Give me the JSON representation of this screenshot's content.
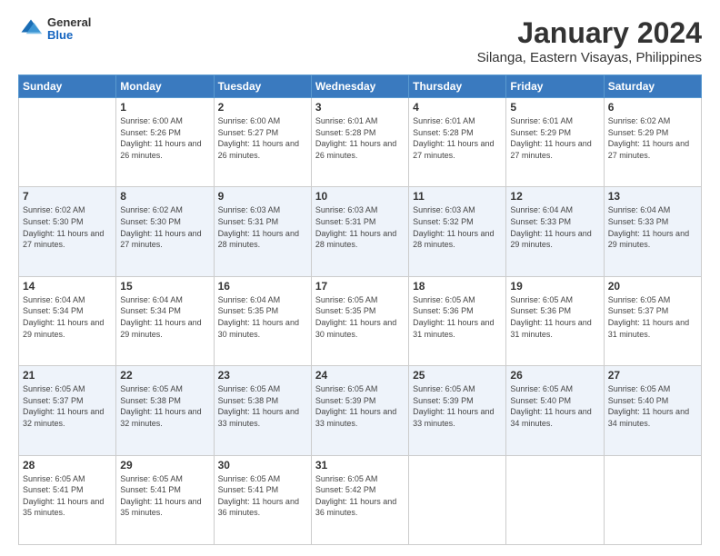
{
  "logo": {
    "general": "General",
    "blue": "Blue"
  },
  "header": {
    "title": "January 2024",
    "subtitle": "Silanga, Eastern Visayas, Philippines"
  },
  "days_of_week": [
    "Sunday",
    "Monday",
    "Tuesday",
    "Wednesday",
    "Thursday",
    "Friday",
    "Saturday"
  ],
  "weeks": [
    [
      {
        "day": "",
        "content": ""
      },
      {
        "day": "1",
        "sunrise": "Sunrise: 6:00 AM",
        "sunset": "Sunset: 5:26 PM",
        "daylight": "Daylight: 11 hours and 26 minutes."
      },
      {
        "day": "2",
        "sunrise": "Sunrise: 6:00 AM",
        "sunset": "Sunset: 5:27 PM",
        "daylight": "Daylight: 11 hours and 26 minutes."
      },
      {
        "day": "3",
        "sunrise": "Sunrise: 6:01 AM",
        "sunset": "Sunset: 5:28 PM",
        "daylight": "Daylight: 11 hours and 26 minutes."
      },
      {
        "day": "4",
        "sunrise": "Sunrise: 6:01 AM",
        "sunset": "Sunset: 5:28 PM",
        "daylight": "Daylight: 11 hours and 27 minutes."
      },
      {
        "day": "5",
        "sunrise": "Sunrise: 6:01 AM",
        "sunset": "Sunset: 5:29 PM",
        "daylight": "Daylight: 11 hours and 27 minutes."
      },
      {
        "day": "6",
        "sunrise": "Sunrise: 6:02 AM",
        "sunset": "Sunset: 5:29 PM",
        "daylight": "Daylight: 11 hours and 27 minutes."
      }
    ],
    [
      {
        "day": "7",
        "sunrise": "Sunrise: 6:02 AM",
        "sunset": "Sunset: 5:30 PM",
        "daylight": "Daylight: 11 hours and 27 minutes."
      },
      {
        "day": "8",
        "sunrise": "Sunrise: 6:02 AM",
        "sunset": "Sunset: 5:30 PM",
        "daylight": "Daylight: 11 hours and 27 minutes."
      },
      {
        "day": "9",
        "sunrise": "Sunrise: 6:03 AM",
        "sunset": "Sunset: 5:31 PM",
        "daylight": "Daylight: 11 hours and 28 minutes."
      },
      {
        "day": "10",
        "sunrise": "Sunrise: 6:03 AM",
        "sunset": "Sunset: 5:31 PM",
        "daylight": "Daylight: 11 hours and 28 minutes."
      },
      {
        "day": "11",
        "sunrise": "Sunrise: 6:03 AM",
        "sunset": "Sunset: 5:32 PM",
        "daylight": "Daylight: 11 hours and 28 minutes."
      },
      {
        "day": "12",
        "sunrise": "Sunrise: 6:04 AM",
        "sunset": "Sunset: 5:33 PM",
        "daylight": "Daylight: 11 hours and 29 minutes."
      },
      {
        "day": "13",
        "sunrise": "Sunrise: 6:04 AM",
        "sunset": "Sunset: 5:33 PM",
        "daylight": "Daylight: 11 hours and 29 minutes."
      }
    ],
    [
      {
        "day": "14",
        "sunrise": "Sunrise: 6:04 AM",
        "sunset": "Sunset: 5:34 PM",
        "daylight": "Daylight: 11 hours and 29 minutes."
      },
      {
        "day": "15",
        "sunrise": "Sunrise: 6:04 AM",
        "sunset": "Sunset: 5:34 PM",
        "daylight": "Daylight: 11 hours and 29 minutes."
      },
      {
        "day": "16",
        "sunrise": "Sunrise: 6:04 AM",
        "sunset": "Sunset: 5:35 PM",
        "daylight": "Daylight: 11 hours and 30 minutes."
      },
      {
        "day": "17",
        "sunrise": "Sunrise: 6:05 AM",
        "sunset": "Sunset: 5:35 PM",
        "daylight": "Daylight: 11 hours and 30 minutes."
      },
      {
        "day": "18",
        "sunrise": "Sunrise: 6:05 AM",
        "sunset": "Sunset: 5:36 PM",
        "daylight": "Daylight: 11 hours and 31 minutes."
      },
      {
        "day": "19",
        "sunrise": "Sunrise: 6:05 AM",
        "sunset": "Sunset: 5:36 PM",
        "daylight": "Daylight: 11 hours and 31 minutes."
      },
      {
        "day": "20",
        "sunrise": "Sunrise: 6:05 AM",
        "sunset": "Sunset: 5:37 PM",
        "daylight": "Daylight: 11 hours and 31 minutes."
      }
    ],
    [
      {
        "day": "21",
        "sunrise": "Sunrise: 6:05 AM",
        "sunset": "Sunset: 5:37 PM",
        "daylight": "Daylight: 11 hours and 32 minutes."
      },
      {
        "day": "22",
        "sunrise": "Sunrise: 6:05 AM",
        "sunset": "Sunset: 5:38 PM",
        "daylight": "Daylight: 11 hours and 32 minutes."
      },
      {
        "day": "23",
        "sunrise": "Sunrise: 6:05 AM",
        "sunset": "Sunset: 5:38 PM",
        "daylight": "Daylight: 11 hours and 33 minutes."
      },
      {
        "day": "24",
        "sunrise": "Sunrise: 6:05 AM",
        "sunset": "Sunset: 5:39 PM",
        "daylight": "Daylight: 11 hours and 33 minutes."
      },
      {
        "day": "25",
        "sunrise": "Sunrise: 6:05 AM",
        "sunset": "Sunset: 5:39 PM",
        "daylight": "Daylight: 11 hours and 33 minutes."
      },
      {
        "day": "26",
        "sunrise": "Sunrise: 6:05 AM",
        "sunset": "Sunset: 5:40 PM",
        "daylight": "Daylight: 11 hours and 34 minutes."
      },
      {
        "day": "27",
        "sunrise": "Sunrise: 6:05 AM",
        "sunset": "Sunset: 5:40 PM",
        "daylight": "Daylight: 11 hours and 34 minutes."
      }
    ],
    [
      {
        "day": "28",
        "sunrise": "Sunrise: 6:05 AM",
        "sunset": "Sunset: 5:41 PM",
        "daylight": "Daylight: 11 hours and 35 minutes."
      },
      {
        "day": "29",
        "sunrise": "Sunrise: 6:05 AM",
        "sunset": "Sunset: 5:41 PM",
        "daylight": "Daylight: 11 hours and 35 minutes."
      },
      {
        "day": "30",
        "sunrise": "Sunrise: 6:05 AM",
        "sunset": "Sunset: 5:41 PM",
        "daylight": "Daylight: 11 hours and 36 minutes."
      },
      {
        "day": "31",
        "sunrise": "Sunrise: 6:05 AM",
        "sunset": "Sunset: 5:42 PM",
        "daylight": "Daylight: 11 hours and 36 minutes."
      },
      {
        "day": "",
        "content": ""
      },
      {
        "day": "",
        "content": ""
      },
      {
        "day": "",
        "content": ""
      }
    ]
  ]
}
